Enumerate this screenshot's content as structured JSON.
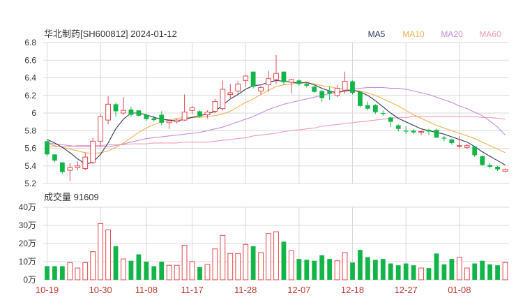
{
  "header": {
    "title": "华北制药[SH600812] 2024-01-12",
    "volume_label": "成交量 91609"
  },
  "colors": {
    "up": "#e0474c",
    "down": "#13b548",
    "ma5": "#2d3555",
    "ma10": "#f2b04c",
    "ma20": "#c58be0",
    "ma60": "#f39bb4",
    "grid": "#d8d8d8",
    "xtick": "#c0392b"
  },
  "chart_data": [
    {
      "type": "candlestick",
      "title": "华北制药[SH600812] 2024-01-12",
      "ylim": [
        5.2,
        6.8
      ],
      "yticks": [
        "6.8",
        "6.6",
        "6.4",
        "6.2",
        "6",
        "5.8",
        "5.6",
        "5.4",
        "5.2"
      ],
      "legend": [
        "MA5",
        "MA10",
        "MA20",
        "MA60"
      ],
      "legend_position": "top-right",
      "ohlc": [
        [
          5.68,
          5.69,
          5.51,
          5.53
        ],
        [
          5.53,
          5.53,
          5.44,
          5.46
        ],
        [
          5.44,
          5.44,
          5.31,
          5.33
        ],
        [
          5.35,
          5.43,
          5.23,
          5.38
        ],
        [
          5.38,
          5.45,
          5.35,
          5.4
        ],
        [
          5.37,
          5.55,
          5.35,
          5.5
        ],
        [
          5.44,
          5.72,
          5.42,
          5.68
        ],
        [
          5.68,
          5.99,
          5.62,
          5.96
        ],
        [
          5.92,
          6.19,
          5.87,
          6.1
        ],
        [
          6.1,
          6.12,
          5.96,
          6.02
        ],
        [
          6.0,
          6.18,
          5.98,
          6.03
        ],
        [
          6.04,
          6.07,
          5.96,
          5.98
        ],
        [
          6.03,
          6.03,
          5.96,
          5.97
        ],
        [
          5.98,
          5.99,
          5.91,
          5.93
        ],
        [
          5.94,
          5.97,
          5.9,
          5.92
        ],
        [
          5.98,
          6.02,
          5.86,
          5.89
        ],
        [
          5.89,
          5.92,
          5.82,
          5.91
        ],
        [
          5.9,
          5.93,
          5.88,
          5.92
        ],
        [
          5.92,
          6.21,
          5.91,
          6.01
        ],
        [
          6.03,
          6.08,
          5.99,
          6.06
        ],
        [
          6.02,
          6.03,
          5.95,
          5.96
        ],
        [
          5.98,
          6.03,
          5.94,
          6.01
        ],
        [
          6.02,
          6.16,
          6.0,
          6.13
        ],
        [
          6.05,
          6.37,
          6.03,
          6.27
        ],
        [
          6.21,
          6.33,
          6.17,
          6.23
        ],
        [
          6.25,
          6.36,
          6.22,
          6.33
        ],
        [
          6.37,
          6.43,
          6.3,
          6.42
        ],
        [
          6.47,
          6.47,
          6.28,
          6.3
        ],
        [
          6.25,
          6.31,
          6.21,
          6.29
        ],
        [
          6.32,
          6.48,
          6.24,
          6.39
        ],
        [
          6.38,
          6.66,
          6.33,
          6.45
        ],
        [
          6.47,
          6.47,
          6.32,
          6.35
        ],
        [
          6.35,
          6.39,
          6.23,
          6.38
        ],
        [
          6.37,
          6.38,
          6.31,
          6.33
        ],
        [
          6.33,
          6.34,
          6.29,
          6.31
        ],
        [
          6.3,
          6.31,
          6.23,
          6.24
        ],
        [
          6.25,
          6.26,
          6.13,
          6.17
        ],
        [
          6.25,
          6.3,
          6.15,
          6.22
        ],
        [
          6.2,
          6.32,
          6.18,
          6.28
        ],
        [
          6.26,
          6.47,
          6.22,
          6.36
        ],
        [
          6.36,
          6.37,
          6.21,
          6.23
        ],
        [
          6.24,
          6.25,
          6.06,
          6.08
        ],
        [
          6.09,
          6.13,
          6.03,
          6.05
        ],
        [
          6.09,
          6.1,
          5.99,
          6.01
        ],
        [
          6.0,
          6.03,
          5.97,
          5.99
        ],
        [
          5.95,
          5.96,
          5.84,
          5.9
        ],
        [
          5.86,
          5.87,
          5.79,
          5.82
        ],
        [
          5.8,
          5.85,
          5.76,
          5.79
        ],
        [
          5.8,
          5.82,
          5.76,
          5.78
        ],
        [
          5.78,
          5.8,
          5.75,
          5.79
        ],
        [
          5.81,
          5.82,
          5.75,
          5.79
        ],
        [
          5.81,
          5.82,
          5.72,
          5.72
        ],
        [
          5.72,
          5.74,
          5.68,
          5.71
        ],
        [
          5.7,
          5.71,
          5.64,
          5.66
        ],
        [
          5.63,
          5.74,
          5.6,
          5.63
        ],
        [
          5.61,
          5.65,
          5.59,
          5.63
        ],
        [
          5.62,
          5.62,
          5.5,
          5.52
        ],
        [
          5.51,
          5.52,
          5.4,
          5.41
        ],
        [
          5.41,
          5.43,
          5.37,
          5.39
        ],
        [
          5.39,
          5.4,
          5.34,
          5.36
        ],
        [
          5.34,
          5.37,
          5.33,
          5.36
        ]
      ],
      "ma5": [
        5.7,
        5.66,
        5.61,
        5.55,
        5.48,
        5.42,
        5.44,
        5.53,
        5.66,
        5.82,
        5.93,
        6.0,
        6.0,
        5.98,
        5.95,
        5.93,
        5.92,
        5.91,
        5.93,
        5.95,
        5.97,
        5.99,
        6.02,
        6.09,
        6.16,
        6.21,
        6.27,
        6.31,
        6.32,
        6.35,
        6.37,
        6.36,
        6.35,
        6.34,
        6.35,
        6.32,
        6.28,
        6.25,
        6.23,
        6.25,
        6.26,
        6.24,
        6.2,
        6.14,
        6.07,
        6.0,
        5.94,
        5.9,
        5.86,
        5.82,
        5.8,
        5.78,
        5.76,
        5.73,
        5.7,
        5.67,
        5.62,
        5.56,
        5.51,
        5.46,
        5.41
      ],
      "ma10": [
        5.65,
        5.63,
        5.61,
        5.59,
        5.57,
        5.55,
        5.54,
        5.55,
        5.57,
        5.61,
        5.66,
        5.72,
        5.78,
        5.83,
        5.87,
        5.9,
        5.92,
        5.94,
        5.95,
        5.95,
        5.95,
        5.96,
        5.97,
        5.99,
        6.02,
        6.07,
        6.12,
        6.16,
        6.21,
        6.26,
        6.3,
        6.32,
        6.33,
        6.34,
        6.34,
        6.33,
        6.31,
        6.3,
        6.28,
        6.27,
        6.26,
        6.25,
        6.23,
        6.2,
        6.16,
        6.12,
        6.08,
        6.03,
        5.98,
        5.94,
        5.9,
        5.86,
        5.83,
        5.8,
        5.77,
        5.74,
        5.71,
        5.67,
        5.63,
        5.59,
        5.55
      ],
      "ma20": [
        5.66,
        5.65,
        5.64,
        5.63,
        5.62,
        5.62,
        5.62,
        5.62,
        5.62,
        5.63,
        5.65,
        5.67,
        5.69,
        5.71,
        5.72,
        5.73,
        5.74,
        5.75,
        5.76,
        5.77,
        5.78,
        5.8,
        5.82,
        5.84,
        5.87,
        5.9,
        5.93,
        5.96,
        6.0,
        6.04,
        6.07,
        6.1,
        6.12,
        6.14,
        6.16,
        6.18,
        6.2,
        6.22,
        6.24,
        6.25,
        6.27,
        6.28,
        6.29,
        6.29,
        6.29,
        6.28,
        6.28,
        6.27,
        6.25,
        6.23,
        6.21,
        6.18,
        6.15,
        6.12,
        6.08,
        6.05,
        6.01,
        5.97,
        5.91,
        5.84,
        5.75
      ],
      "ma60": [
        5.62,
        5.62,
        5.62,
        5.62,
        5.63,
        5.63,
        5.63,
        5.63,
        5.64,
        5.64,
        5.64,
        5.65,
        5.65,
        5.65,
        5.66,
        5.66,
        5.66,
        5.66,
        5.67,
        5.67,
        5.67,
        5.67,
        5.68,
        5.69,
        5.7,
        5.71,
        5.72,
        5.74,
        5.75,
        5.76,
        5.77,
        5.79,
        5.8,
        5.81,
        5.82,
        5.83,
        5.85,
        5.86,
        5.87,
        5.88,
        5.89,
        5.9,
        5.91,
        5.92,
        5.93,
        5.94,
        5.95,
        5.95,
        5.96,
        5.96,
        5.96,
        5.96,
        5.96,
        5.96,
        5.96,
        5.96,
        5.96,
        5.95,
        5.95,
        5.94,
        5.93
      ]
    },
    {
      "type": "bar",
      "title": "成交量 91609",
      "ylim": [
        0,
        40
      ],
      "yticks": [
        "40万",
        "30万",
        "20万",
        "10万",
        "0万"
      ],
      "values": [
        7.5,
        7.5,
        7.5,
        9.5,
        6.5,
        9.5,
        15.5,
        31.0,
        27.5,
        18.5,
        11.5,
        10.5,
        14.0,
        10.0,
        7.5,
        10.0,
        8.0,
        8.0,
        19.0,
        10.0,
        7.0,
        8.5,
        17.0,
        24.5,
        14.5,
        14.5,
        19.5,
        18.5,
        15.0,
        25.5,
        26.5,
        21.0,
        16.0,
        11.5,
        11.0,
        10.5,
        13.5,
        11.5,
        10.5,
        15.0,
        9.5,
        16.5,
        12.5,
        11.0,
        11.5,
        9.0,
        8.0,
        9.0,
        8.0,
        6.5,
        6.5,
        14.5,
        8.5,
        11.5,
        12.5,
        6.5,
        9.0,
        10.5,
        8.5,
        8.0,
        9.5
      ],
      "xticks": [
        "10-19",
        "10-30",
        "11-08",
        "11-17",
        "11-28",
        "12-07",
        "12-18",
        "12-27",
        "01-08"
      ],
      "xtick_index": [
        0,
        7,
        13,
        19,
        26,
        33,
        40,
        47,
        54
      ]
    }
  ]
}
